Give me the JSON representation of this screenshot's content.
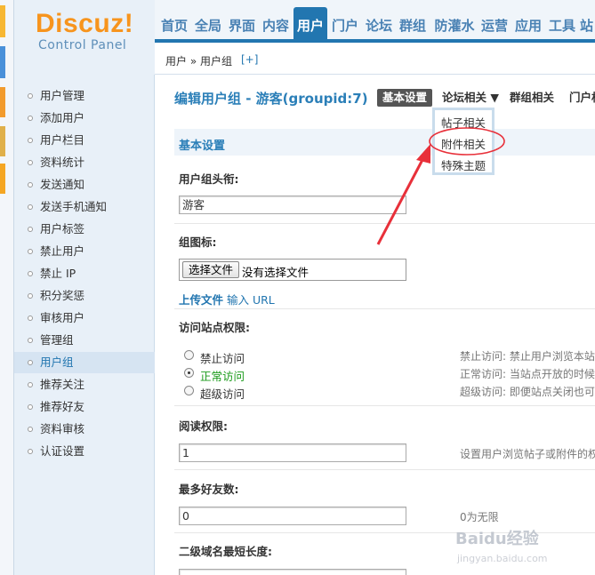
{
  "logo": {
    "main": "Discuz!",
    "sub": "Control Panel"
  },
  "topnav": {
    "items": [
      "首页",
      "全局",
      "界面",
      "内容",
      "用户",
      "门户",
      "论坛",
      "群组",
      "防灌水",
      "运营",
      "应用",
      "工具",
      "站"
    ],
    "active_index": 4
  },
  "breadcrumb": {
    "path": "用户 » 用户组",
    "add": "[+]"
  },
  "sidebar": {
    "items": [
      "用户管理",
      "添加用户",
      "用户栏目",
      "资料统计",
      "发送通知",
      "发送手机通知",
      "用户标签",
      "禁止用户",
      "禁止 IP",
      "积分奖惩",
      "审核用户",
      "管理组",
      "用户组",
      "推荐关注",
      "推荐好友",
      "资料审核",
      "认证设置"
    ],
    "active_index": 12
  },
  "main": {
    "title": "编辑用户组 - 游客(groupid:7)",
    "tabs": [
      "基本设置",
      "论坛相关 ▼",
      "群组相关",
      "门户相"
    ],
    "active_tab": 0,
    "dropdown": [
      "帖子相关",
      "附件相关",
      "特殊主题"
    ],
    "section": "基本设置",
    "fields": {
      "title_label": "用户组头衔:",
      "title_value": "游客",
      "icon_label": "组图标:",
      "file_button": "选择文件",
      "file_status": "没有选择文件",
      "upload_link": "上传文件",
      "input_url_link": "输入 URL",
      "access_label": "访问站点权限:",
      "access_options": [
        "禁止访问",
        "正常访问",
        "超级访问"
      ],
      "access_selected": 1,
      "access_tips": [
        "禁止访问: 禁止用户浏览本站",
        "正常访问: 当站点开放的时候",
        "超级访问: 即便站点关闭也可"
      ],
      "read_label": "阅读权限:",
      "read_value": "1",
      "read_tip": "设置用户浏览帖子或附件的权",
      "friends_label": "最多好友数:",
      "friends_value": "0",
      "friends_tip": "0为无限",
      "domain_label": "二级域名最短长度:"
    }
  },
  "watermark": {
    "main": "Baidu经验",
    "sub": "jingyan.baidu.com"
  },
  "colors": {
    "brand_orange": "#f7941d",
    "nav_blue": "#2276b0",
    "annotation_red": "#e8303a"
  }
}
